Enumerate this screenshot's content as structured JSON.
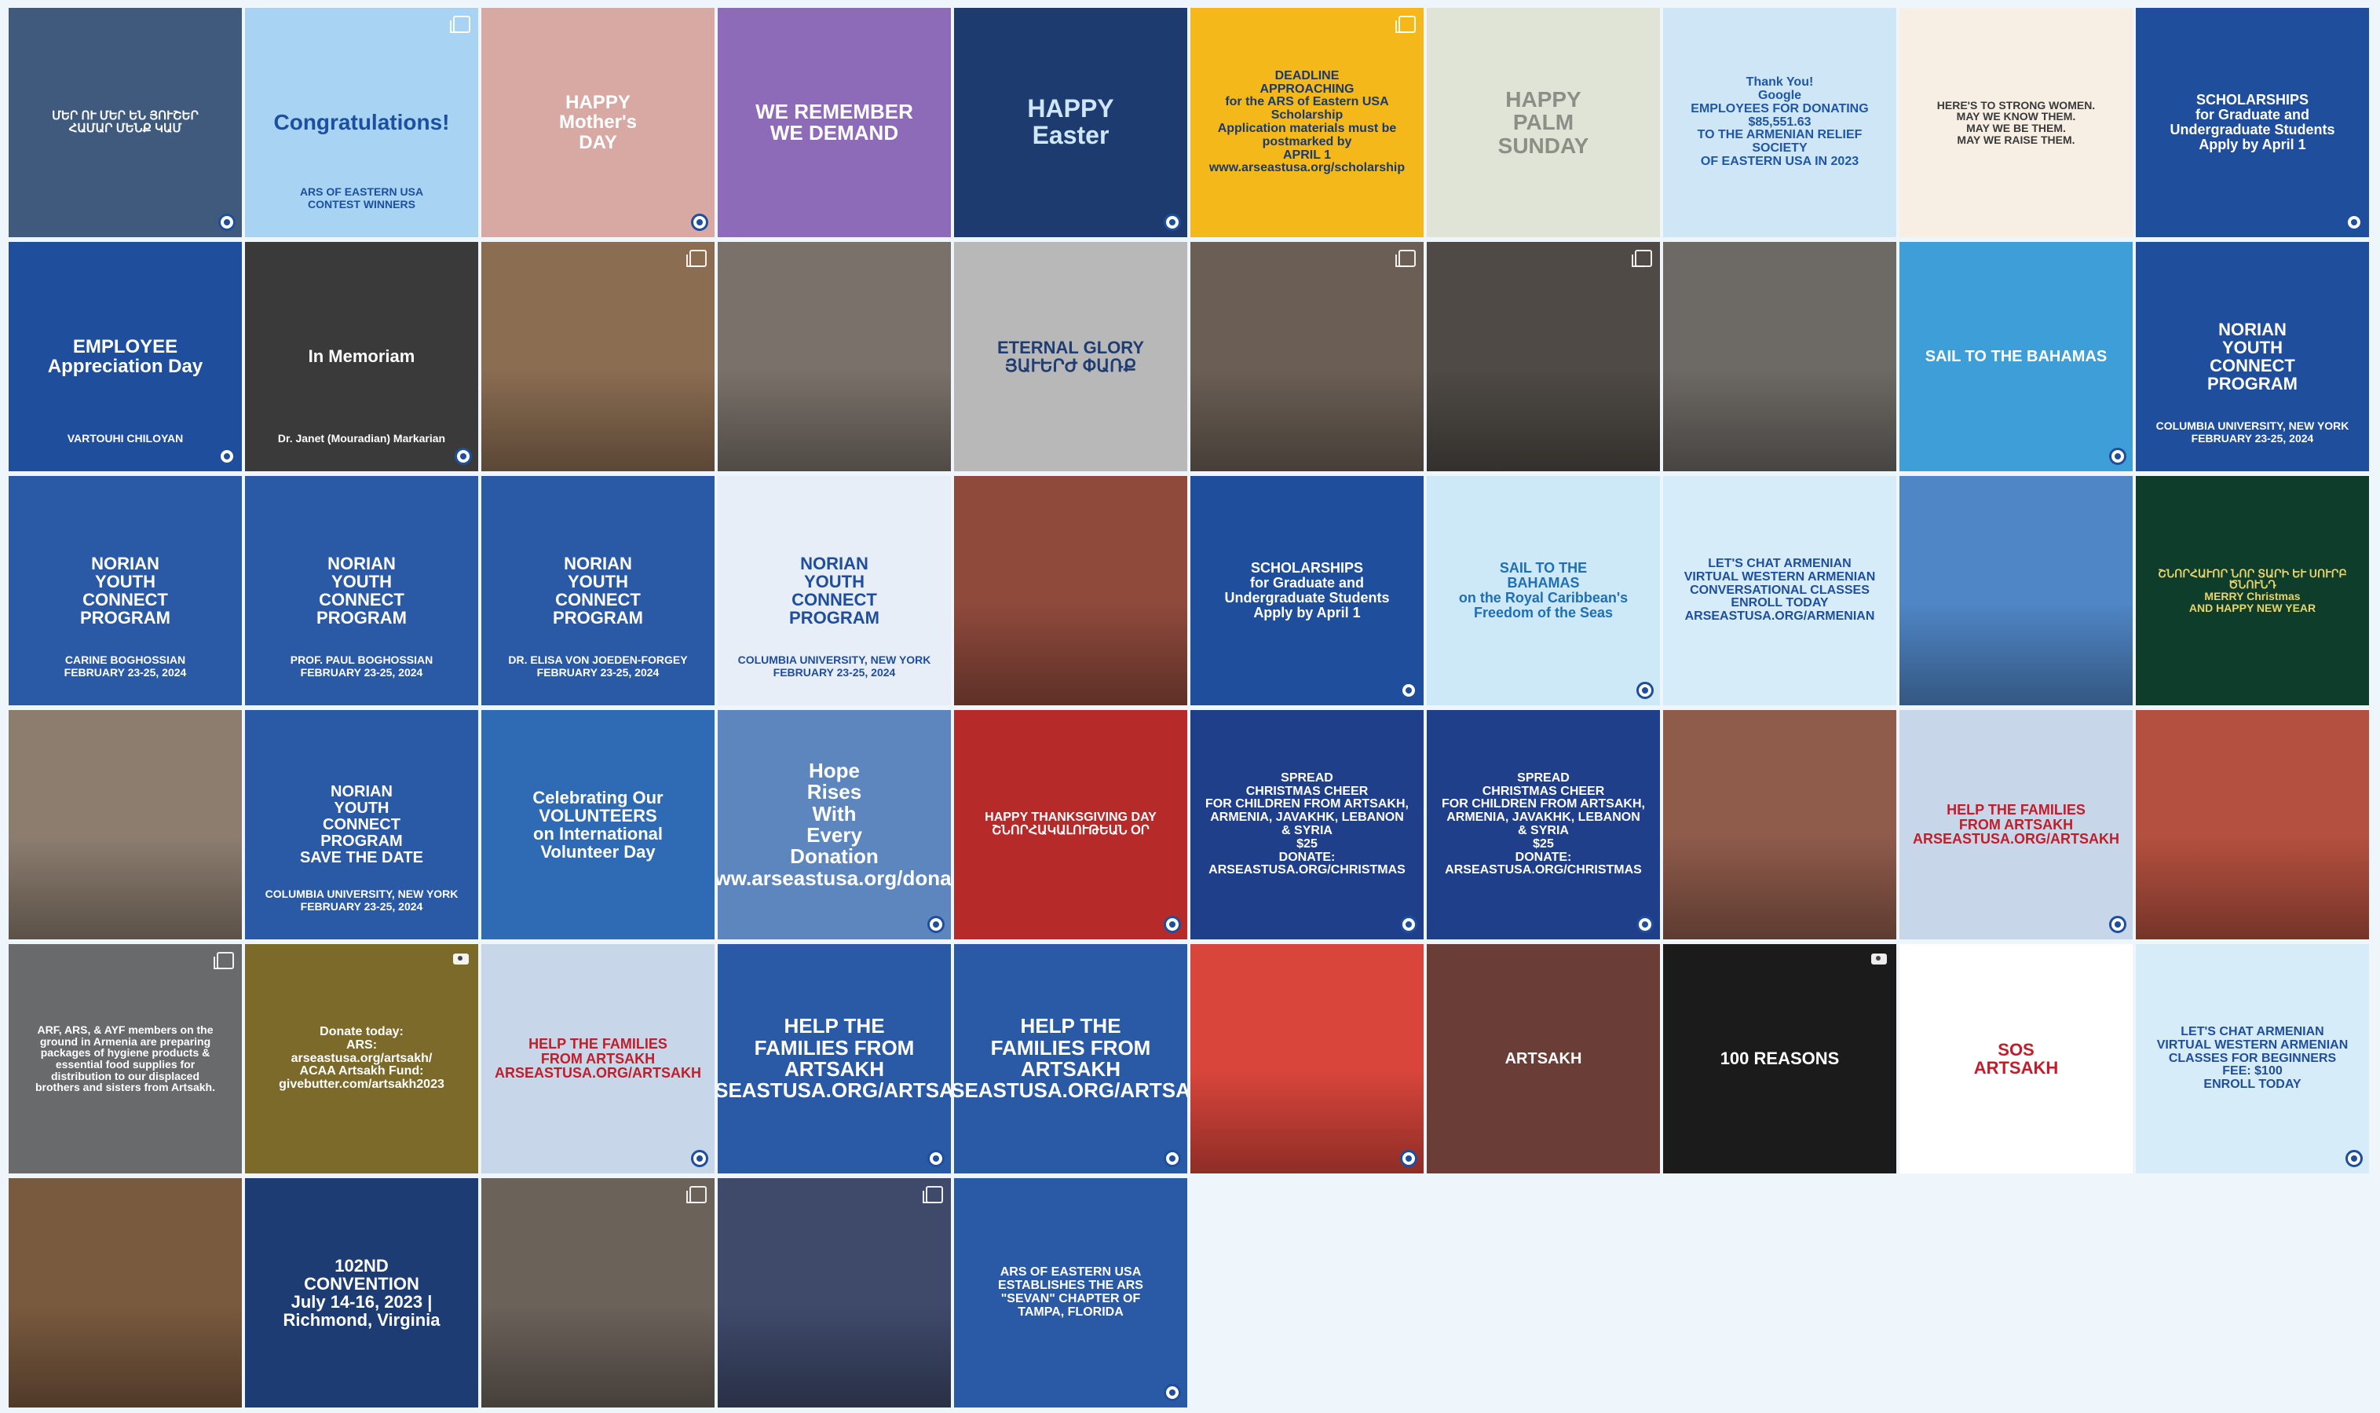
{
  "tiles": [
    {
      "text": "ՄԵՐ ՈՒ ՄԵՐ ԵՆ ՅՈՒՇԵՐ\nՀԱՄԱՐ ՄԵՆՔ ԿԱՄ",
      "bg": "#3f5a7d",
      "fg": "#ffffff",
      "size": 15,
      "overlay": "seal"
    },
    {
      "text": "Congratulations!",
      "sub": "ARS OF EASTERN USA\nCONTEST WINNERS",
      "bg": "#a9d3f3",
      "fg": "#1c4fa0",
      "size": 28,
      "overlay": "multi"
    },
    {
      "text": "HAPPY\nMother's\nDAY",
      "bg": "#d8a9a3",
      "fg": "#ffffff",
      "size": 24,
      "overlay": "seal"
    },
    {
      "text": "WE REMEMBER\nWE DEMAND",
      "bg": "#8e6bb8",
      "fg": "#ffffff",
      "size": 26,
      "overlay": "none"
    },
    {
      "text": "HAPPY\nEaster",
      "bg": "#1d3b6e",
      "fg": "#cfe6ff",
      "size": 32,
      "overlay": "seal"
    },
    {
      "text": "DEADLINE\nAPPROACHING\nfor the ARS of Eastern USA Scholarship\nApplication materials must be postmarked by\nAPRIL 1\nwww.arseastusa.org/scholarship",
      "bg": "#f5b81a",
      "fg": "#1b3a6b",
      "size": 16,
      "overlay": "multi"
    },
    {
      "text": "HAPPY\nPALM\nSUNDAY",
      "bg": "#dfe4d7",
      "fg": "#8c8f86",
      "size": 28,
      "overlay": "none"
    },
    {
      "text": "Thank You!\nGoogle\nEMPLOYEES FOR DONATING\n$85,551.63\nTO THE ARMENIAN RELIEF SOCIETY\nOF EASTERN USA IN 2023",
      "bg": "#cfe6f6",
      "fg": "#1f57a6",
      "size": 16,
      "overlay": "none"
    },
    {
      "text": "HERE'S TO STRONG WOMEN.\nMAY WE KNOW THEM.\nMAY WE BE THEM.\nMAY WE RAISE THEM.",
      "bg": "#f7eee4",
      "fg": "#3a3a3a",
      "size": 14,
      "overlay": "none"
    },
    {
      "text": "SCHOLARSHIPS\nfor Graduate and Undergraduate Students\nApply by April 1",
      "bg": "#1f4e9c",
      "fg": "#ffffff",
      "size": 18,
      "overlay": "seal"
    },
    {
      "text": "EMPLOYEE\nAppreciation Day",
      "sub": "VARTOUHI CHILOYAN",
      "bg": "#1f4e9c",
      "fg": "#ffffff",
      "size": 24,
      "overlay": "seal"
    },
    {
      "text": "In Memoriam",
      "sub": "Dr. Janet (Mouradian) Markarian",
      "bg": "#3a3a3a",
      "fg": "#ffffff",
      "size": 22,
      "overlay": "seal"
    },
    {
      "text": "",
      "bg": "#8b6d52",
      "fg": "#ffffff",
      "size": 18,
      "overlay": "multi"
    },
    {
      "text": "",
      "bg": "#7a726a",
      "fg": "#ffffff",
      "size": 18,
      "overlay": "none"
    },
    {
      "text": "ETERNAL GLORY\nՅԱՒԵՐԺ ՓԱՌՔ",
      "bg": "#b8b8b8",
      "fg": "#1f3d73",
      "size": 22,
      "overlay": "none"
    },
    {
      "text": "",
      "bg": "#6b5f55",
      "fg": "#ffffff",
      "size": 18,
      "overlay": "multi"
    },
    {
      "text": "",
      "bg": "#4f4a45",
      "fg": "#ffffff",
      "size": 18,
      "overlay": "multi"
    },
    {
      "text": "",
      "bg": "#6d6a65",
      "fg": "#ffffff",
      "size": 18,
      "overlay": "none"
    },
    {
      "text": "SAIL TO THE BAHAMAS",
      "bg": "#3d9ed8",
      "fg": "#ffffff",
      "size": 20,
      "overlay": "seal"
    },
    {
      "text": "NORIAN\nYOUTH\nCONNECT\nPROGRAM",
      "sub": "COLUMBIA UNIVERSITY, NEW YORK\nFEBRUARY 23-25, 2024",
      "bg": "#1f4e9c",
      "fg": "#ffffff",
      "size": 22,
      "overlay": "none"
    },
    {
      "text": "NORIAN\nYOUTH\nCONNECT\nPROGRAM",
      "sub": "CARINE BOGHOSSIAN\nFEBRUARY 23-25, 2024",
      "bg": "#2a5aa6",
      "fg": "#ffffff",
      "size": 22,
      "overlay": "none"
    },
    {
      "text": "NORIAN\nYOUTH\nCONNECT\nPROGRAM",
      "sub": "PROF. PAUL BOGHOSSIAN\nFEBRUARY 23-25, 2024",
      "bg": "#2a5aa6",
      "fg": "#ffffff",
      "size": 22,
      "overlay": "none"
    },
    {
      "text": "NORIAN\nYOUTH\nCONNECT\nPROGRAM",
      "sub": "DR. ELISA VON JOEDEN-FORGEY\nFEBRUARY 23-25, 2024",
      "bg": "#2a5aa6",
      "fg": "#ffffff",
      "size": 22,
      "overlay": "none"
    },
    {
      "text": "NORIAN\nYOUTH\nCONNECT\nPROGRAM",
      "sub": "COLUMBIA UNIVERSITY, NEW YORK\nFEBRUARY 23-25, 2024",
      "bg": "#e8eef7",
      "fg": "#1f4e9c",
      "size": 22,
      "overlay": "none"
    },
    {
      "text": "",
      "bg": "#8f4a3c",
      "fg": "#ffffff",
      "size": 18,
      "overlay": "none"
    },
    {
      "text": "SCHOLARSHIPS\nfor Graduate and Undergraduate Students\nApply by April 1",
      "bg": "#1f4e9c",
      "fg": "#ffffff",
      "size": 18,
      "overlay": "seal"
    },
    {
      "text": "SAIL TO THE\nBAHAMAS\non the Royal Caribbean's\nFreedom of the Seas",
      "bg": "#cde8f6",
      "fg": "#1f6fb4",
      "size": 18,
      "overlay": "seal"
    },
    {
      "text": "LET'S CHAT ARMENIAN\nVIRTUAL WESTERN ARMENIAN CONVERSATIONAL CLASSES\nENROLL TODAY\nARSEASTUSA.ORG/ARMENIAN",
      "bg": "#d7ecf9",
      "fg": "#1f4e9c",
      "size": 16,
      "overlay": "none"
    },
    {
      "text": "",
      "bg": "#4f86c6",
      "fg": "#ffffff",
      "size": 18,
      "overlay": "none"
    },
    {
      "text": "ՇՆՈՐՀԱՒՈՐ ՆՈՐ ՏԱՐԻ ԵՒ ՍՈՒՐԲ ԾՆՈՒՆԴ\nMERRY Christmas\nAND HAPPY NEW YEAR",
      "bg": "#0f3d2c",
      "fg": "#e9d46a",
      "size": 14,
      "overlay": "none"
    },
    {
      "text": "",
      "bg": "#8c7d6f",
      "fg": "#ffffff",
      "size": 18,
      "overlay": "none"
    },
    {
      "text": "NORIAN\nYOUTH\nCONNECT\nPROGRAM\nSAVE THE DATE",
      "sub": "COLUMBIA UNIVERSITY, NEW YORK\nFEBRUARY 23-25, 2024",
      "bg": "#2a5aa6",
      "fg": "#ffffff",
      "size": 20,
      "overlay": "none"
    },
    {
      "text": "Celebrating Our\nVOLUNTEERS\non International Volunteer Day",
      "bg": "#2f6bb5",
      "fg": "#ffffff",
      "size": 22,
      "overlay": "none"
    },
    {
      "text": "Hope\nRises\nWith\nEvery\nDonation\nwww.arseastusa.org/donate",
      "bg": "#5c86bd",
      "fg": "#ffffff",
      "size": 26,
      "overlay": "seal"
    },
    {
      "text": "HAPPY THANKSGIVING DAY\nՇՆՈՐՀԱԿԱԼՈՒԹԵԱՆ ՕՐ",
      "bg": "#b62a2a",
      "fg": "#ffffff",
      "size": 16,
      "overlay": "seal"
    },
    {
      "text": "SPREAD\nCHRISTMAS CHEER\nFOR CHILDREN FROM ARTSAKH,\nARMENIA, JAVAKHK, LEBANON & SYRIA\n$25\nDONATE:\nARSEASTUSA.ORG/CHRISTMAS",
      "bg": "#1f3f8a",
      "fg": "#ffffff",
      "size": 16,
      "overlay": "seal"
    },
    {
      "text": "SPREAD\nCHRISTMAS CHEER\nFOR CHILDREN FROM ARTSAKH,\nARMENIA, JAVAKHK, LEBANON & SYRIA\n$25\nDONATE:\nARSEASTUSA.ORG/CHRISTMAS",
      "bg": "#1f3f8a",
      "fg": "#ffffff",
      "size": 16,
      "overlay": "seal"
    },
    {
      "text": "",
      "bg": "#8f5b4b",
      "fg": "#ffffff",
      "size": 18,
      "overlay": "none"
    },
    {
      "text": "HELP THE FAMILIES\nFROM ARTSAKH\nARSEASTUSA.ORG/ARTSAKH",
      "bg": "#c7d6e8",
      "fg": "#c21d2a",
      "size": 18,
      "overlay": "seal"
    },
    {
      "text": "",
      "bg": "#b4503f",
      "fg": "#ffffff",
      "size": 18,
      "overlay": "none"
    },
    {
      "text": "ARF, ARS, & AYF members on the\nground in Armenia are preparing\npackages of hygiene products &\nessential food supplies for\ndistribution to our displaced\nbrothers and sisters from Artsakh.",
      "bg": "#696a6b",
      "fg": "#ffffff",
      "size": 14,
      "overlay": "multi"
    },
    {
      "text": "Donate today:\nARS:\narseastusa.org/artsakh/\nACAA Artsakh Fund:\ngivebutter.com/artsakh2023",
      "bg": "#7c6a2b",
      "fg": "#ffffff",
      "size": 16,
      "overlay": "cam"
    },
    {
      "text": "HELP THE FAMILIES\nFROM ARTSAKH\nARSEASTUSA.ORG/ARTSAKH",
      "bg": "#c7d6e8",
      "fg": "#c21d2a",
      "size": 18,
      "overlay": "seal"
    },
    {
      "text": "HELP THE\nFAMILIES FROM\nARTSAKH\nARSEASTUSA.ORG/ARTSAKH",
      "bg": "#2a5aa6",
      "fg": "#ffffff",
      "size": 26,
      "overlay": "seal"
    },
    {
      "text": "HELP THE\nFAMILIES FROM\nARTSAKH\nARSEASTUSA.ORG/ARTSAKH",
      "bg": "#2a5aa6",
      "fg": "#ffffff",
      "size": 26,
      "overlay": "seal"
    },
    {
      "text": "",
      "bg": "#d9453b",
      "fg": "#ffffff",
      "size": 18,
      "overlay": "seal"
    },
    {
      "text": "ARTSAKH",
      "bg": "#6a3d36",
      "fg": "#ffffff",
      "size": 20,
      "overlay": "none"
    },
    {
      "text": "100 REASONS",
      "bg": "#1b1b1b",
      "fg": "#ffffff",
      "size": 22,
      "overlay": "cam"
    },
    {
      "text": "SOS\nARTSAKH",
      "bg": "#ffffff",
      "fg": "#c21d2a",
      "size": 22,
      "overlay": "none"
    },
    {
      "text": "LET'S CHAT ARMENIAN\nVIRTUAL WESTERN ARMENIAN CLASSES FOR BEGINNERS\nFEE: $100\nENROLL TODAY",
      "bg": "#d7ecf9",
      "fg": "#1f4e9c",
      "size": 16,
      "overlay": "seal"
    },
    {
      "text": "",
      "bg": "#7a5a3f",
      "fg": "#ffffff",
      "size": 18,
      "overlay": "none"
    },
    {
      "text": "102ND\nCONVENTION\nJuly 14-16, 2023 | Richmond, Virginia",
      "bg": "#1c3c73",
      "fg": "#ffffff",
      "size": 22,
      "overlay": "none"
    },
    {
      "text": "",
      "bg": "#6b625a",
      "fg": "#ffffff",
      "size": 18,
      "overlay": "multi"
    },
    {
      "text": "",
      "bg": "#3f4a6b",
      "fg": "#ffffff",
      "size": 18,
      "overlay": "multi"
    },
    {
      "text": "ARS OF EASTERN USA\nESTABLISHES THE ARS\n\"SEVAN\" CHAPTER OF\nTAMPA, FLORIDA",
      "bg": "#2a5aa6",
      "fg": "#ffffff",
      "size": 16,
      "overlay": "seal"
    }
  ]
}
